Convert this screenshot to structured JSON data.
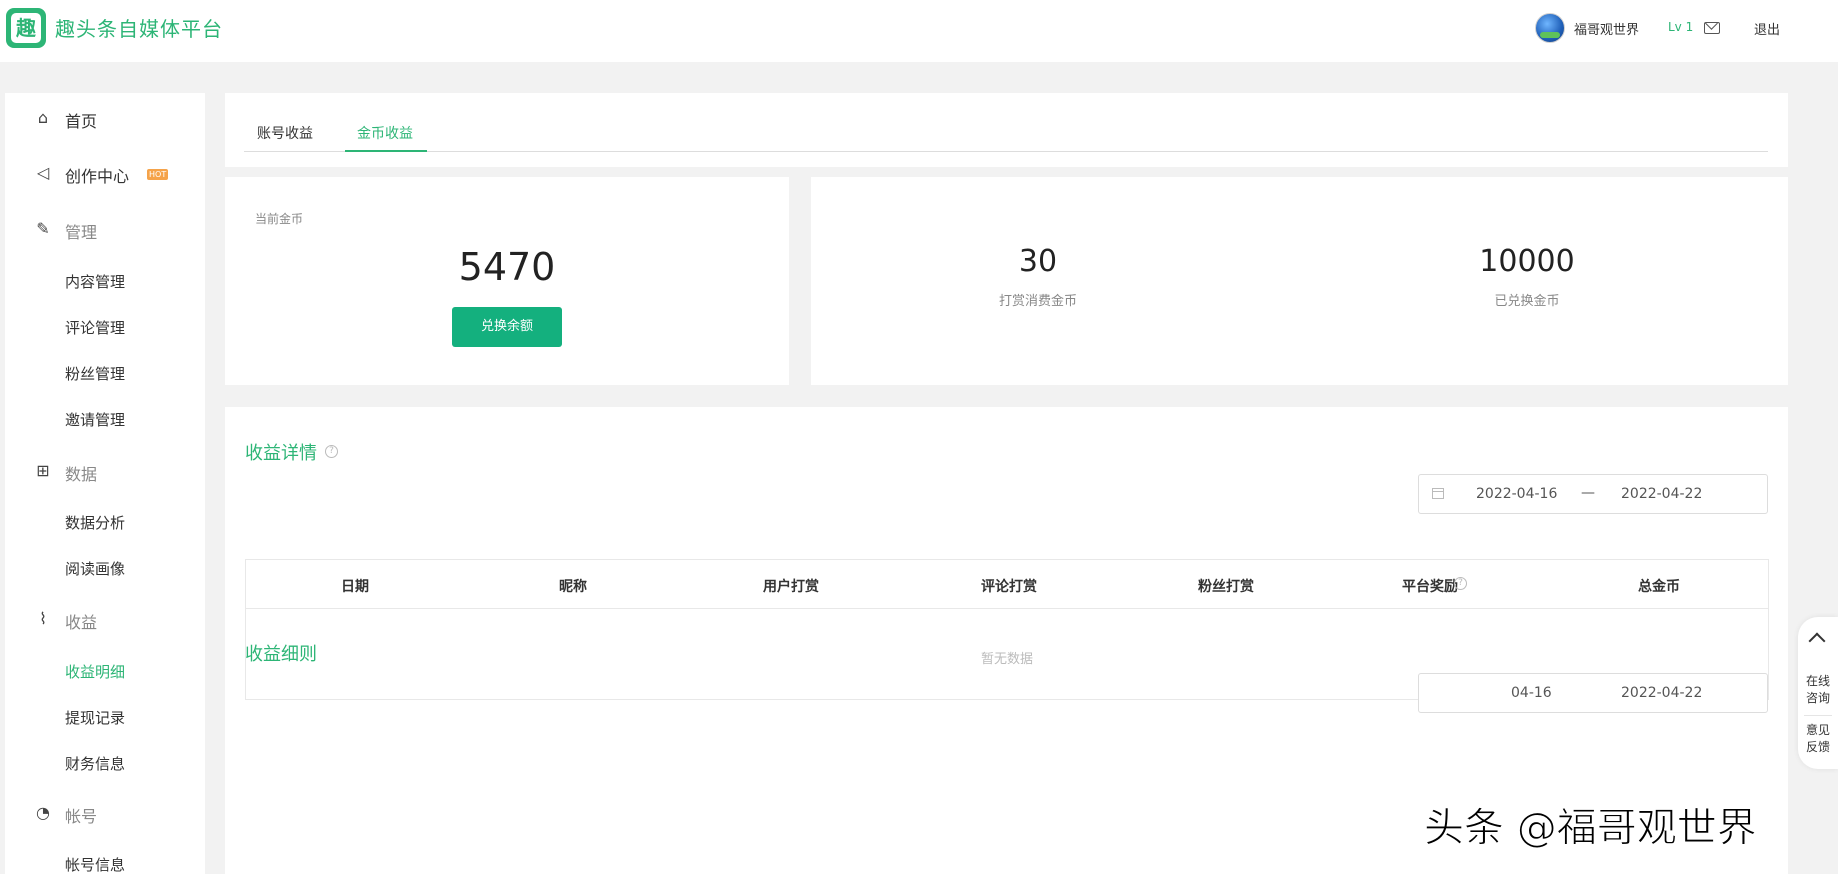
{
  "header": {
    "logo_char": "趣",
    "brand": "趣头条自媒体平台",
    "username": "福哥观世界",
    "level": "Lv 1",
    "logout": "退出"
  },
  "sidebar": {
    "home": "首页",
    "create": "创作中心",
    "hot_badge": "HOT",
    "manage": "管理",
    "manage_items": [
      "内容管理",
      "评论管理",
      "粉丝管理",
      "邀请管理"
    ],
    "data": "数据",
    "data_items": [
      "数据分析",
      "阅读画像"
    ],
    "income": "收益",
    "income_items": [
      "收益明细",
      "提现记录",
      "财务信息"
    ],
    "account": "帐号",
    "account_items": [
      "帐号信息"
    ]
  },
  "tabs": [
    "账号收益",
    "金币收益"
  ],
  "coins": {
    "label": "当前金币",
    "value": "5470",
    "button": "兑换余额"
  },
  "stats": [
    {
      "value": "30",
      "label": "打赏消费金币"
    },
    {
      "value": "10000",
      "label": "已兑换金币"
    }
  ],
  "detail": {
    "title": "收益详情",
    "help": "?",
    "date_start": "2022-04-16",
    "date_sep": "—",
    "date_end": "2022-04-22",
    "columns": [
      "日期",
      "昵称",
      "用户打赏",
      "评论打赏",
      "粉丝打赏",
      "平台奖励",
      "总金币"
    ],
    "empty": "暂无数据"
  },
  "rules": {
    "title": "收益细则",
    "date_start": "04-16",
    "date_end": "2022-04-22"
  },
  "float_panel": {
    "consult": "在线\n咨询",
    "feedback": "意见\n反馈"
  },
  "watermark": "头条 @福哥观世界",
  "colors": {
    "accent": "#2db576",
    "button": "#14b07e",
    "hot": "#f5a34a"
  }
}
